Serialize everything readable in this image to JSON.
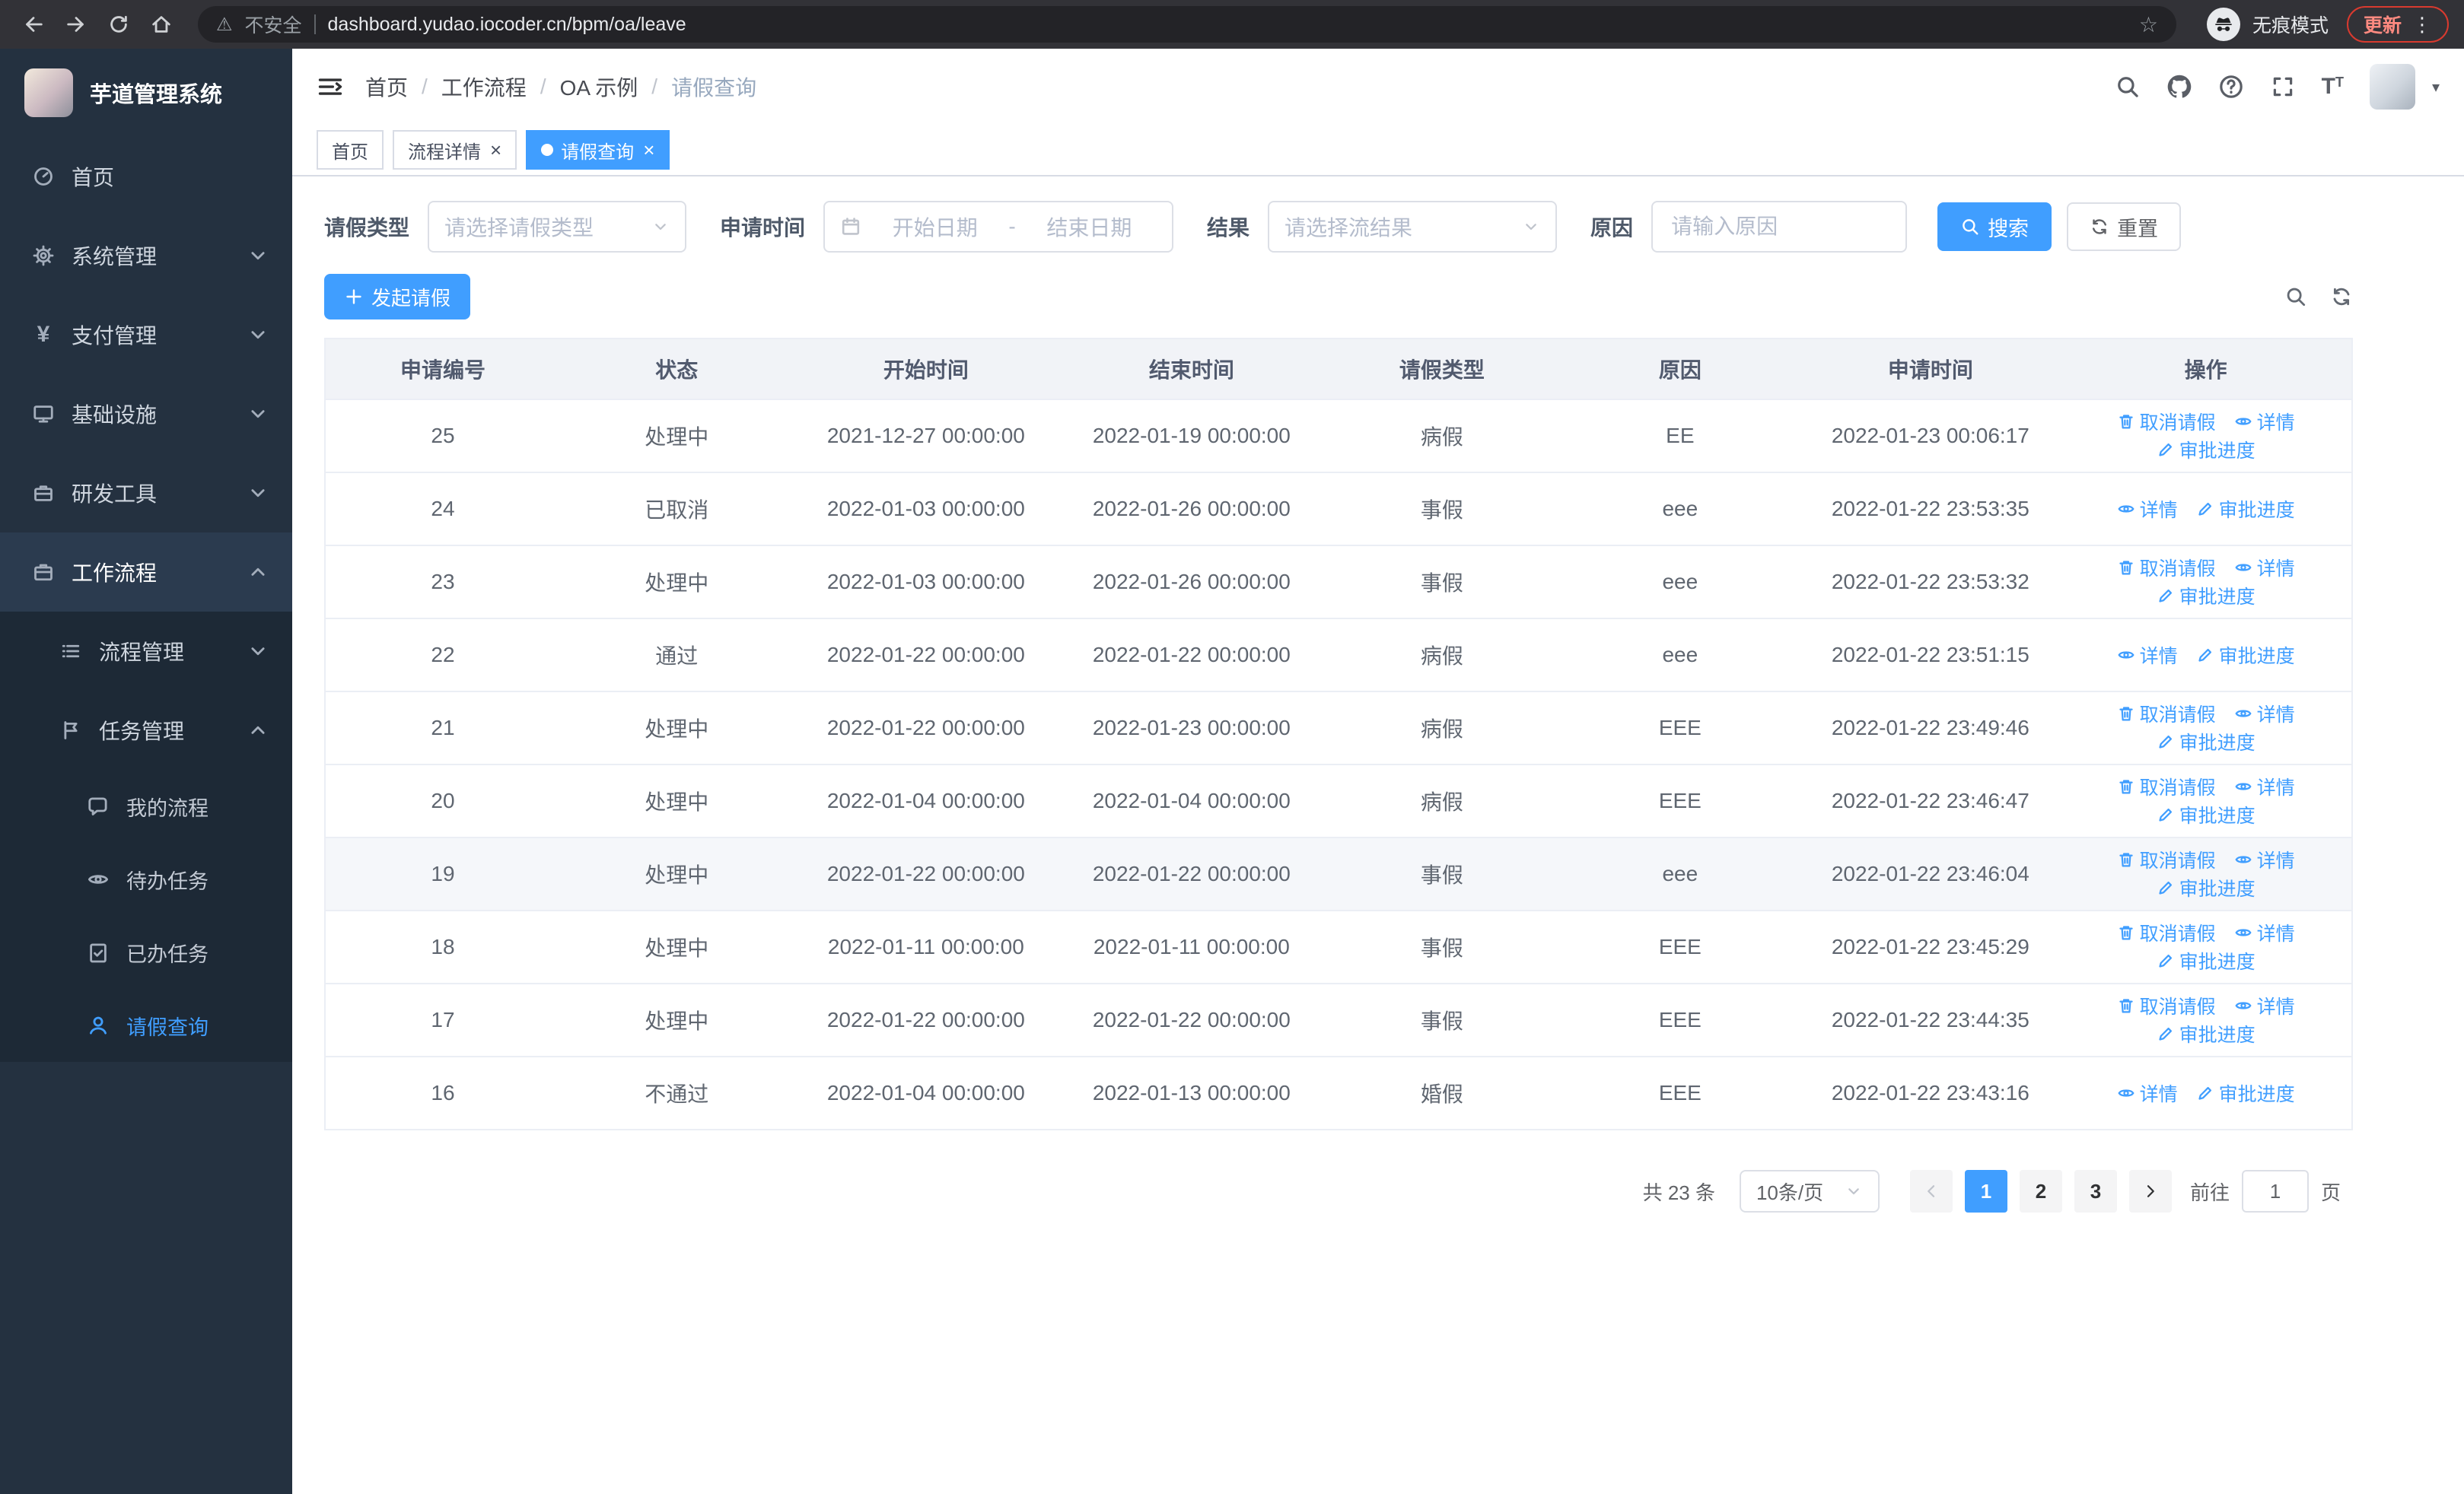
{
  "browser": {
    "url": "dashboard.yudao.iocoder.cn/bpm/oa/leave",
    "security_warning": "不安全",
    "incognito_label": "无痕模式",
    "update_button": "更新"
  },
  "sidebar": {
    "logo_title": "芋道管理系统",
    "menu": [
      {
        "name": "home",
        "label": "首页",
        "icon": "dashboard-icon"
      },
      {
        "name": "system-management",
        "label": "系统管理",
        "icon": "gear-icon",
        "state": "collapsed"
      },
      {
        "name": "payment-management",
        "label": "支付管理",
        "icon": "yen-icon",
        "state": "collapsed"
      },
      {
        "name": "infrastructure",
        "label": "基础设施",
        "icon": "monitor-icon",
        "state": "collapsed"
      },
      {
        "name": "dev-tools",
        "label": "研发工具",
        "icon": "toolbox-icon",
        "state": "collapsed"
      },
      {
        "name": "workflow",
        "label": "工作流程",
        "icon": "briefcase-icon",
        "state": "expanded",
        "children": [
          {
            "name": "process-management",
            "label": "流程管理",
            "icon": "list-icon",
            "state": "collapsed"
          },
          {
            "name": "task-management",
            "label": "任务管理",
            "icon": "tasks-icon",
            "state": "expanded",
            "children": [
              {
                "name": "my-processes",
                "label": "我的流程",
                "icon": "chat-icon"
              },
              {
                "name": "todo-tasks",
                "label": "待办任务",
                "icon": "eye-icon"
              },
              {
                "name": "done-tasks",
                "label": "已办任务",
                "icon": "done-icon"
              },
              {
                "name": "leave-query",
                "label": "请假查询",
                "icon": "user-icon",
                "active": true
              }
            ]
          }
        ]
      }
    ]
  },
  "breadcrumb": [
    "首页",
    "工作流程",
    "OA 示例",
    "请假查询"
  ],
  "tabs": [
    {
      "name": "home",
      "label": "首页",
      "closable": false,
      "active": false
    },
    {
      "name": "process-detail",
      "label": "流程详情",
      "closable": true,
      "active": false
    },
    {
      "name": "leave-query",
      "label": "请假查询",
      "closable": true,
      "active": true
    }
  ],
  "filters": {
    "leave_type": {
      "label": "请假类型",
      "placeholder": "请选择请假类型"
    },
    "apply_time": {
      "label": "申请时间",
      "start_placeholder": "开始日期",
      "separator": "-",
      "end_placeholder": "结束日期"
    },
    "result": {
      "label": "结果",
      "placeholder": "请选择流结果"
    },
    "reason": {
      "label": "原因",
      "placeholder": "请输入原因"
    },
    "search_button": "搜索",
    "reset_button": "重置"
  },
  "toolbar": {
    "create_button": "发起请假"
  },
  "table": {
    "columns": [
      "申请编号",
      "状态",
      "开始时间",
      "结束时间",
      "请假类型",
      "原因",
      "申请时间",
      "操作"
    ],
    "action_labels": {
      "cancel": "取消请假",
      "detail": "详情",
      "progress": "审批进度"
    },
    "rows": [
      {
        "id": "25",
        "status": "处理中",
        "start": "2021-12-27 00:00:00",
        "end": "2022-01-19 00:00:00",
        "type": "病假",
        "reason": "EE",
        "applied": "2022-01-23 00:06:17",
        "actions": [
          "cancel",
          "detail",
          "progress"
        ]
      },
      {
        "id": "24",
        "status": "已取消",
        "start": "2022-01-03 00:00:00",
        "end": "2022-01-26 00:00:00",
        "type": "事假",
        "reason": "eee",
        "applied": "2022-01-22 23:53:35",
        "actions": [
          "detail",
          "progress"
        ]
      },
      {
        "id": "23",
        "status": "处理中",
        "start": "2022-01-03 00:00:00",
        "end": "2022-01-26 00:00:00",
        "type": "事假",
        "reason": "eee",
        "applied": "2022-01-22 23:53:32",
        "actions": [
          "cancel",
          "detail",
          "progress"
        ]
      },
      {
        "id": "22",
        "status": "通过",
        "start": "2022-01-22 00:00:00",
        "end": "2022-01-22 00:00:00",
        "type": "病假",
        "reason": "eee",
        "applied": "2022-01-22 23:51:15",
        "actions": [
          "detail",
          "progress"
        ]
      },
      {
        "id": "21",
        "status": "处理中",
        "start": "2022-01-22 00:00:00",
        "end": "2022-01-23 00:00:00",
        "type": "病假",
        "reason": "EEE",
        "applied": "2022-01-22 23:49:46",
        "actions": [
          "cancel",
          "detail",
          "progress"
        ]
      },
      {
        "id": "20",
        "status": "处理中",
        "start": "2022-01-04 00:00:00",
        "end": "2022-01-04 00:00:00",
        "type": "病假",
        "reason": "EEE",
        "applied": "2022-01-22 23:46:47",
        "actions": [
          "cancel",
          "detail",
          "progress"
        ]
      },
      {
        "id": "19",
        "status": "处理中",
        "start": "2022-01-22 00:00:00",
        "end": "2022-01-22 00:00:00",
        "type": "事假",
        "reason": "eee",
        "applied": "2022-01-22 23:46:04",
        "actions": [
          "cancel",
          "detail",
          "progress"
        ],
        "highlighted": true
      },
      {
        "id": "18",
        "status": "处理中",
        "start": "2022-01-11 00:00:00",
        "end": "2022-01-11 00:00:00",
        "type": "事假",
        "reason": "EEE",
        "applied": "2022-01-22 23:45:29",
        "actions": [
          "cancel",
          "detail",
          "progress"
        ]
      },
      {
        "id": "17",
        "status": "处理中",
        "start": "2022-01-22 00:00:00",
        "end": "2022-01-22 00:00:00",
        "type": "事假",
        "reason": "EEE",
        "applied": "2022-01-22 23:44:35",
        "actions": [
          "cancel",
          "detail",
          "progress"
        ]
      },
      {
        "id": "16",
        "status": "不通过",
        "start": "2022-01-04 00:00:00",
        "end": "2022-01-13 00:00:00",
        "type": "婚假",
        "reason": "EEE",
        "applied": "2022-01-22 23:43:16",
        "actions": [
          "detail",
          "progress"
        ]
      }
    ]
  },
  "pagination": {
    "total_text": "共 23 条",
    "page_size": "10条/页",
    "pages": [
      "1",
      "2",
      "3"
    ],
    "active_page": "1",
    "goto_prefix": "前往",
    "goto_value": "1",
    "goto_suffix": "页"
  },
  "colors": {
    "primary": "#409eff",
    "sidebar_bg": "#243140",
    "sidebar_submenu_bg": "#1d2936",
    "update_badge": "#d93a2f"
  }
}
